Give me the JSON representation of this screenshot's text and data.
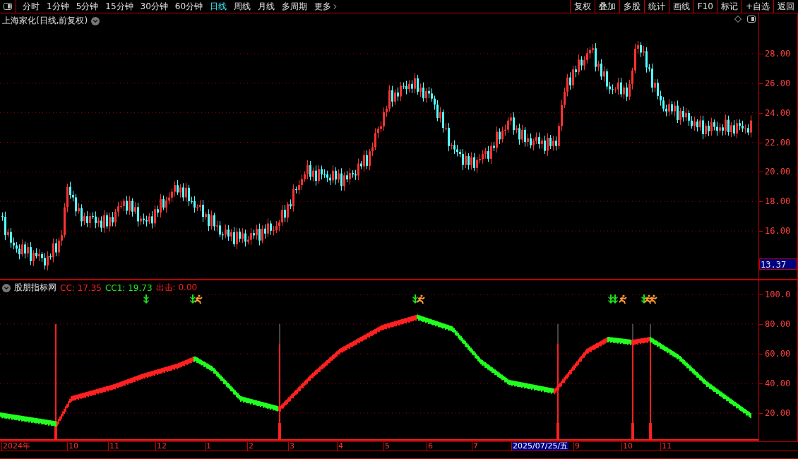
{
  "toolbar": {
    "periods": [
      {
        "label": "分时",
        "selected": false
      },
      {
        "label": "1分钟",
        "selected": false
      },
      {
        "label": "5分钟",
        "selected": false
      },
      {
        "label": "15分钟",
        "selected": false
      },
      {
        "label": "30分钟",
        "selected": false
      },
      {
        "label": "60分钟",
        "selected": false
      },
      {
        "label": "日线",
        "selected": true
      },
      {
        "label": "周线",
        "selected": false
      },
      {
        "label": "月线",
        "selected": false
      },
      {
        "label": "多周期",
        "selected": false
      }
    ],
    "more": "更多",
    "actions": [
      "复权",
      "叠加",
      "多股",
      "统计",
      "画线",
      "F10",
      "标记",
      "+自选",
      "返回"
    ]
  },
  "main_chart": {
    "title": "上海家化(日线,前复权)",
    "yticks": [
      "28.00",
      "26.00",
      "24.00",
      "22.00",
      "20.00",
      "18.00",
      "16.00"
    ],
    "current_price": "13.37"
  },
  "indicator": {
    "name": "股朋指标网",
    "values": [
      {
        "label": "CC: 17.35",
        "color": "#ff2020"
      },
      {
        "label": "CC1: 19.73",
        "color": "#20ee20"
      },
      {
        "label": "出击: 0.00",
        "color": "#ff2020"
      }
    ],
    "yticks": [
      "100.0",
      "80.00",
      "60.00",
      "40.00",
      "20.00"
    ]
  },
  "x_axis": [
    {
      "label": "2024年",
      "selected": false
    },
    {
      "label": "10",
      "selected": false
    },
    {
      "label": "11",
      "selected": false
    },
    {
      "label": "12",
      "selected": false
    },
    {
      "label": "1",
      "selected": false
    },
    {
      "label": "2",
      "selected": false
    },
    {
      "label": "3",
      "selected": false
    },
    {
      "label": "4",
      "selected": false
    },
    {
      "label": "5",
      "selected": false
    },
    {
      "label": "6",
      "selected": false
    },
    {
      "label": "7",
      "selected": false
    },
    {
      "label": "2025/07/25/五",
      "selected": true
    },
    {
      "label": "9",
      "selected": false
    },
    {
      "label": "10",
      "selected": false
    },
    {
      "label": "11",
      "selected": false
    }
  ]
}
